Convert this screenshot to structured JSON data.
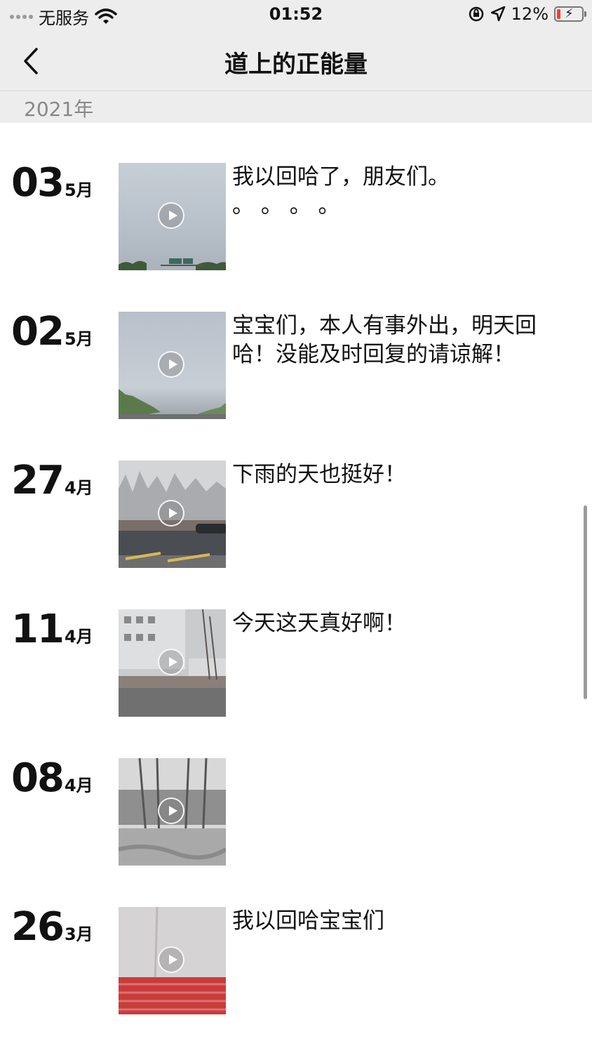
{
  "status_bar": {
    "carrier": "无服务",
    "time": "01:52",
    "battery_percent": "12%",
    "battery_level": 0.12,
    "icons": [
      "signal-dots-icon",
      "wifi-icon",
      "orientation-lock-icon",
      "location-icon",
      "battery-charging-icon"
    ]
  },
  "nav": {
    "title": "道上的正能量",
    "back_icon": "chevron-left-icon"
  },
  "year_header": "2021年",
  "entries": [
    {
      "day": "03",
      "month": "5月",
      "caption": "我以回哈了，朋友们。\n。 。 。 。"
    },
    {
      "day": "02",
      "month": "5月",
      "caption": "宝宝们，本人有事外出，明天回哈！没能及时回复的请谅解！"
    },
    {
      "day": "27",
      "month": "4月",
      "caption": "下雨的天也挺好！"
    },
    {
      "day": "11",
      "month": "4月",
      "caption": "今天这天真好啊！"
    },
    {
      "day": "08",
      "month": "4月",
      "caption": ""
    },
    {
      "day": "26",
      "month": "3月",
      "caption": "我以回哈宝宝们"
    }
  ],
  "colors": {
    "header_bg": "#ededed",
    "battery_low": "#ff3b30"
  }
}
